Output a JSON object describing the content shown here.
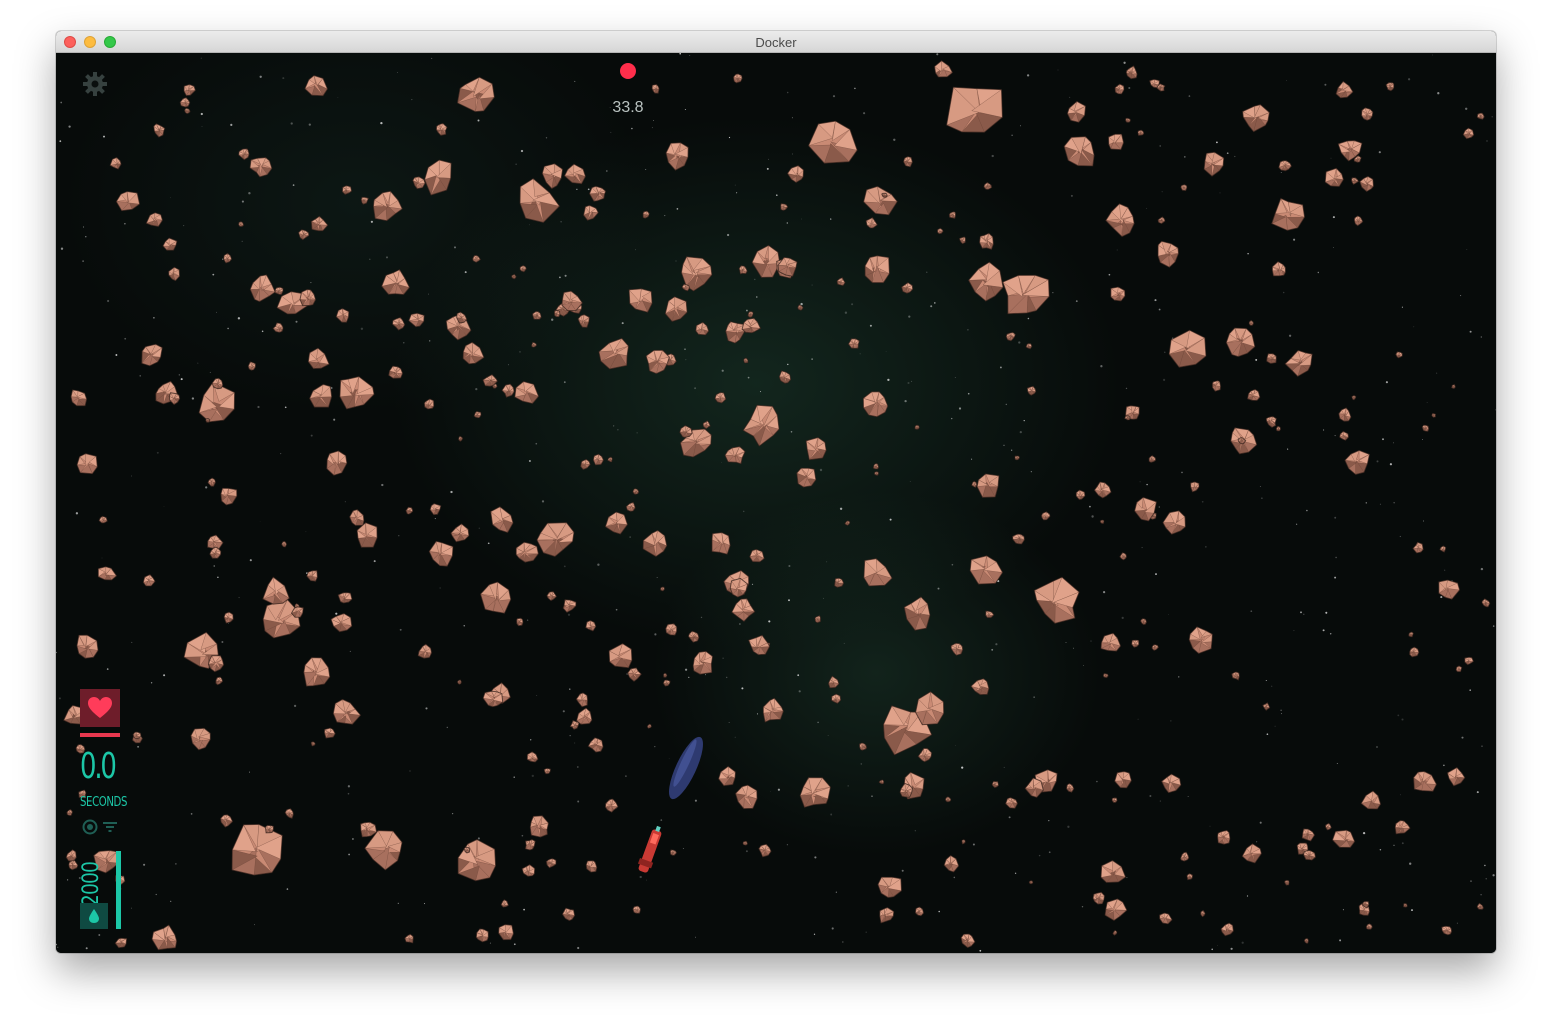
{
  "window": {
    "title": "Docker"
  },
  "hud": {
    "top_timer": "33.8",
    "lives_indicator_color": "#ff2e4b",
    "health": {
      "icon": "heart-icon",
      "fill": 1.0,
      "color": "#e8384f"
    },
    "survival": {
      "value": "0.0",
      "unit": "SECONDS"
    },
    "fuel": {
      "value": "2000",
      "icon": "droplet-icon",
      "fill": 1.0,
      "color": "#1cc7a7"
    },
    "settings_icon": "gear-icon",
    "mode_icons": [
      "target-icon",
      "filter-icon"
    ]
  },
  "scene": {
    "background": "deep-space starfield with green nebula",
    "asteroid_color": "#c98a74",
    "player_ship": {
      "icon": "red-rocket-ship",
      "color": "#d8413a"
    },
    "enemy_ship": {
      "icon": "blue-capsule-ship",
      "color": "#3a4a86"
    }
  }
}
